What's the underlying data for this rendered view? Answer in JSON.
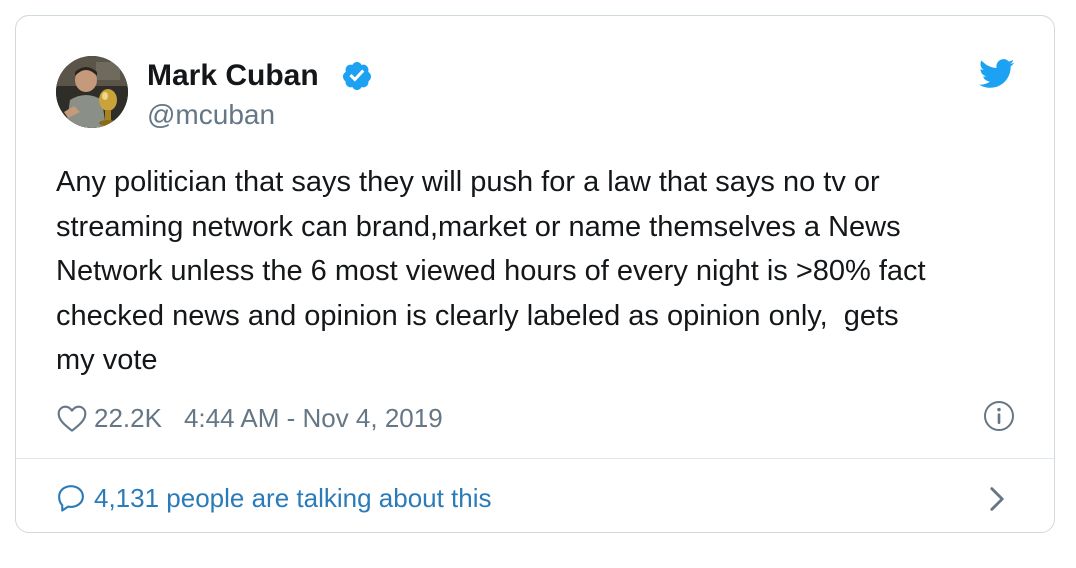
{
  "author": {
    "name": "Mark Cuban",
    "handle": "@mcuban"
  },
  "tweet": {
    "text": "Any politician that says they will push for a law that says no tv or\nstreaming network can brand,market or name themselves a News\nNetwork unless the 6 most viewed hours of every night is >80% fact\nchecked news and opinion is clearly labeled as opinion only,  gets\nmy vote",
    "like_count": "22.2K",
    "timestamp": "4:44 AM - Nov 4, 2019"
  },
  "footer": {
    "talking_label": "4,131 people are talking about this"
  },
  "icons": {
    "verified": "verified-badge-icon",
    "bird": "twitter-bird-icon",
    "heart": "heart-icon",
    "info": "info-icon",
    "bubble": "speech-bubble-icon",
    "chevron": "chevron-right-icon"
  },
  "colors": {
    "brand_blue": "#1da1f2",
    "link_blue": "#2b7bb9",
    "text_primary": "#14171a",
    "text_secondary": "#657786",
    "border": "#cfd9de"
  }
}
